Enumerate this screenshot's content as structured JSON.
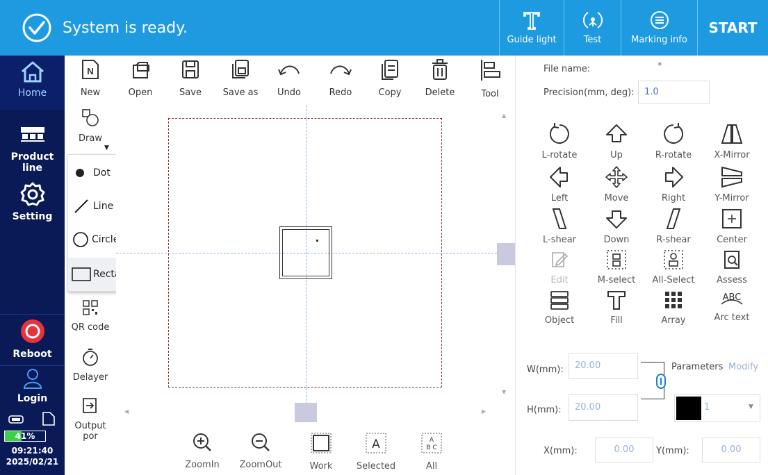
{
  "topbar": {
    "status": "System is ready.",
    "guide_light": "Guide light",
    "test": "Test",
    "marking_info": "Marking info",
    "start": "START"
  },
  "nav": {
    "home": "Home",
    "product_line": "Product line",
    "setting": "Setting",
    "reboot": "Reboot",
    "login": "Login",
    "battery": "41%",
    "time": "09:21:40",
    "date": "2025/02/21"
  },
  "toolbar": {
    "new": "New",
    "open": "Open",
    "save": "Save",
    "save_as": "Save as",
    "undo": "Undo",
    "redo": "Redo",
    "copy": "Copy",
    "delete": "Delete",
    "tool": "Tool"
  },
  "drawcol": {
    "draw": "Draw",
    "qr": "QR code",
    "delayer": "Delayer",
    "output": "Output por"
  },
  "drawmenu": {
    "dot": "Dot",
    "line": "Line",
    "circle": "Circle",
    "rectangle": "Rectangle"
  },
  "zoombar": {
    "zoomin": "ZoomIn",
    "zoomout": "ZoomOut",
    "work": "Work",
    "selected": "Selected",
    "all": "All"
  },
  "right": {
    "file_name_label": "File name:",
    "file_name_value": "*",
    "precision_label": "Precision(mm, deg):",
    "precision_value": "1.0",
    "tools": {
      "l_rotate": "L-rotate",
      "up": "Up",
      "r_rotate": "R-rotate",
      "x_mirror": "X-Mirror",
      "left": "Left",
      "move": "Move",
      "right": "Right",
      "y_mirror": "Y-Mirror",
      "l_shear": "L-shear",
      "down": "Down",
      "r_shear": "R-shear",
      "center": "Center",
      "edit": "Edit",
      "m_select": "M-select",
      "all_select": "All-Select",
      "assess": "Assess",
      "object": "Object",
      "fill": "Fill",
      "array": "Array",
      "arc_text": "Arc text"
    },
    "w_label": "W(mm):",
    "w_value": "20.00",
    "h_label": "H(mm):",
    "h_value": "20.00",
    "parameters": "Parameters",
    "modify": "Modify",
    "pen_value": "1",
    "x_label": "X(mm):",
    "x_value": "0.00",
    "y_label": "Y(mm):",
    "y_value": "0.00"
  },
  "colors": {
    "topbar": "#1e9be0",
    "nav": "#0a1a56",
    "reboot": "#e8323c",
    "battery": "#3bd14a",
    "accent_text": "#4b6db8"
  }
}
